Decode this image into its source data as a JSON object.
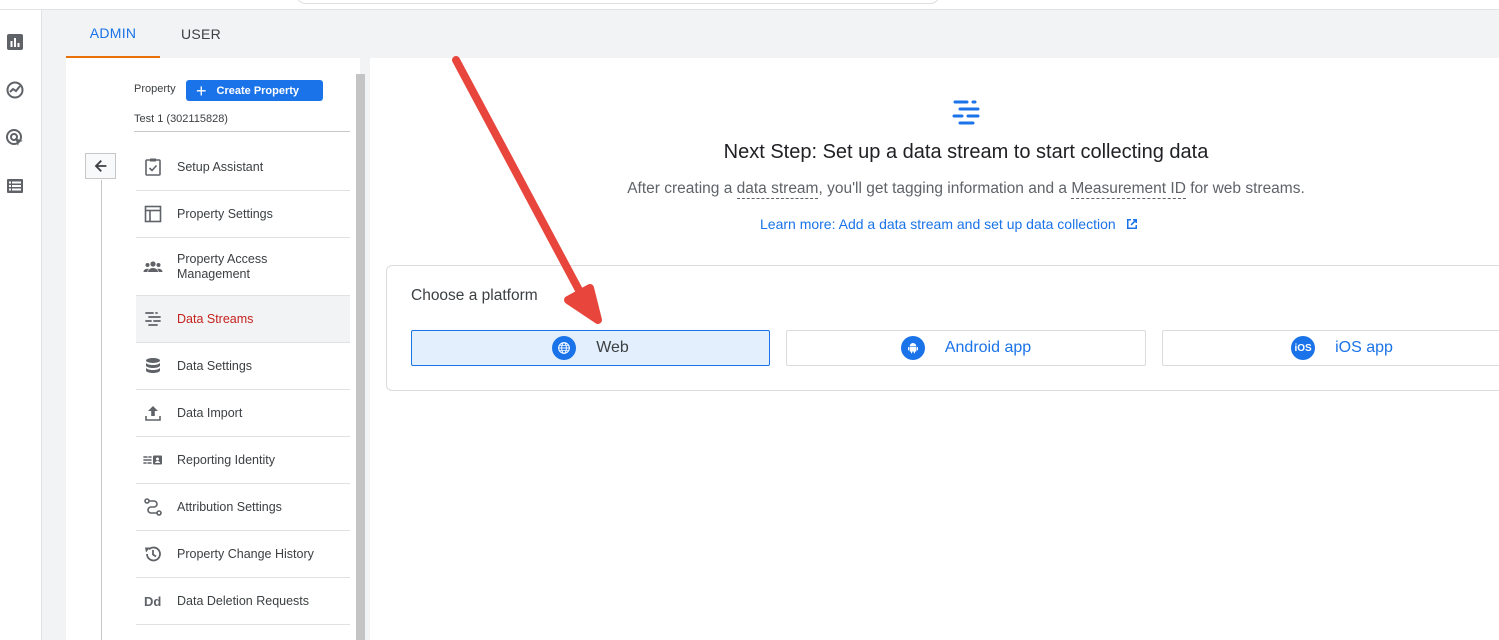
{
  "tabs": {
    "admin": "ADMIN",
    "user": "USER"
  },
  "property": {
    "label": "Property",
    "create_label": "Create Property",
    "name": "Test 1 (302115828)"
  },
  "menu": [
    {
      "label": "Setup Assistant",
      "icon": "clipboard-check-icon"
    },
    {
      "label": "Property Settings",
      "icon": "window-icon"
    },
    {
      "label": "Property Access Management",
      "icon": "people-icon"
    },
    {
      "label": "Data Streams",
      "icon": "data-streams-icon",
      "active": true
    },
    {
      "label": "Data Settings",
      "icon": "database-icon"
    },
    {
      "label": "Data Import",
      "icon": "upload-icon"
    },
    {
      "label": "Reporting Identity",
      "icon": "identity-icon"
    },
    {
      "label": "Attribution Settings",
      "icon": "attribution-icon"
    },
    {
      "label": "Property Change History",
      "icon": "history-icon"
    },
    {
      "label": "Data Deletion Requests",
      "icon": "dd-icon"
    }
  ],
  "main": {
    "title": "Next Step: Set up a data stream to start collecting data",
    "subtitle_before": "After creating a ",
    "subtitle_term1": "data stream",
    "subtitle_mid": ", you'll get tagging information and a ",
    "subtitle_term2": "Measurement ID",
    "subtitle_after": " for web streams.",
    "learn_more": "Learn more: Add a data stream and set up data collection",
    "choose_platform": "Choose a platform",
    "platforms": {
      "web": "Web",
      "android": "Android app",
      "ios": "iOS app",
      "ios_badge": "iOS"
    }
  },
  "colors": {
    "accent": "#1a73e8",
    "active_menu": "#c5221f",
    "tab_indicator": "#e8710a",
    "annotation_arrow": "#e8453c"
  }
}
